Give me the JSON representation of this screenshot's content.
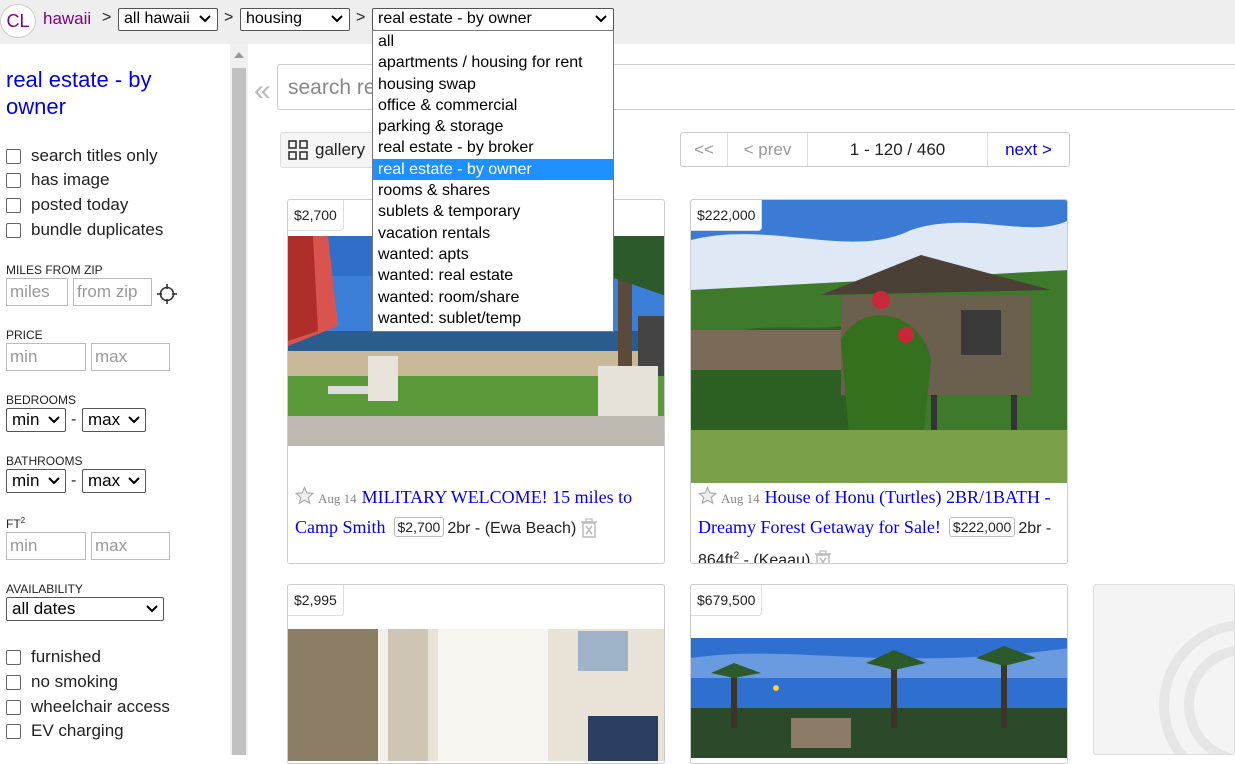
{
  "header": {
    "logo": "CL",
    "site": "hawaii",
    "separator": ">",
    "area_select": "all hawaii",
    "section_select": "housing",
    "category_select": "real estate - by owner"
  },
  "dropdown": {
    "options": [
      "all",
      "apartments / housing for rent",
      "housing swap",
      "office & commercial",
      "parking & storage",
      "real estate - by broker",
      "real estate - by owner",
      "rooms & shares",
      "sublets & temporary",
      "vacation rentals",
      "wanted: apts",
      "wanted: real estate",
      "wanted: room/share",
      "wanted: sublet/temp"
    ],
    "selected_index": 6,
    "highlight_color": "#1e90ff"
  },
  "sidebar": {
    "title": "real estate - by owner",
    "checks_top": [
      "search titles only",
      "has image",
      "posted today",
      "bundle duplicates"
    ],
    "miles_label": "MILES FROM ZIP",
    "miles_placeholder": "miles",
    "zip_placeholder": "from zip",
    "price_label": "PRICE",
    "min_placeholder": "min",
    "max_placeholder": "max",
    "bedrooms_label": "BEDROOMS",
    "bathrooms_label": "BATHROOMS",
    "ft_label": "FT",
    "ft_sup": "2",
    "availability_label": "AVAILABILITY",
    "availability_value": "all dates",
    "select_min": "min",
    "select_max": "max",
    "dash": "-",
    "checks_bottom": [
      "furnished",
      "no smoking",
      "wheelchair access",
      "EV charging"
    ]
  },
  "main": {
    "collapse_icon": "«",
    "search_placeholder": "search real estate - by owner",
    "gallery_label": "gallery",
    "pager": {
      "first": "<<",
      "prev": "< prev",
      "range": "1 - 120 / 460",
      "next": "next >"
    }
  },
  "cards": [
    {
      "price": "$2,700",
      "date": "Aug 14",
      "title": "MILITARY WELCOME! 15 miles to Camp Smith",
      "price_chip": "$2,700",
      "housing": "2br - (Ewa Beach)"
    },
    {
      "price": "$222,000",
      "date": "Aug 14",
      "title": "House of Honu (Turtles) 2BR/1BATH - Dreamy Forest Getaway for Sale!",
      "price_chip": "$222,000",
      "housing_pre": "2br - 864ft",
      "housing_sup": "2",
      "housing_post": " - (Keaau)"
    },
    {
      "price": "$2,995"
    },
    {
      "price": "$679,500"
    }
  ]
}
